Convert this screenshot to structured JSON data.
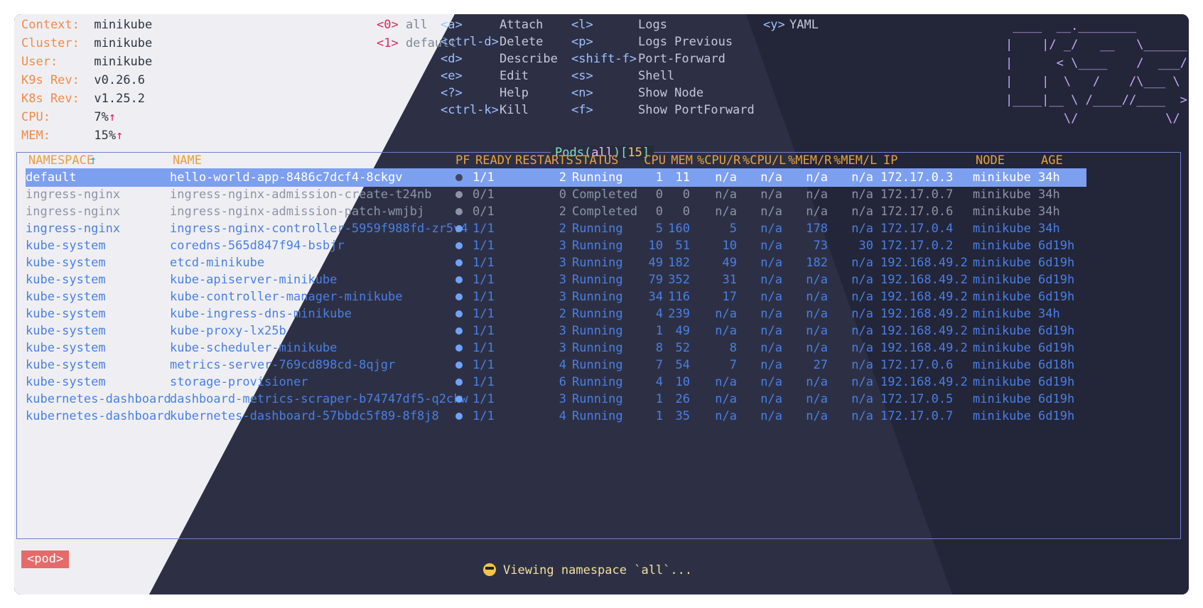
{
  "header": {
    "context": {
      "label": "Context:",
      "value": "minikube"
    },
    "cluster": {
      "label": "Cluster:",
      "value": "minikube"
    },
    "user": {
      "label": "User:",
      "value": "minikube"
    },
    "k9s_rev": {
      "label": "K9s Rev:",
      "value": "v0.26.6"
    },
    "k8s_rev": {
      "label": "K8s Rev:",
      "value": "v1.25.2"
    },
    "cpu": {
      "label": "CPU:",
      "value": "7%",
      "trend": "↑"
    },
    "mem": {
      "label": "MEM:",
      "value": "15%",
      "trend": "↑"
    }
  },
  "namespaces": [
    {
      "shortcut": "<0>",
      "name": "all"
    },
    {
      "shortcut": "<1>",
      "name": "default"
    }
  ],
  "hotkeys": [
    {
      "key": "<a>",
      "action": "Attach"
    },
    {
      "key": "<ctrl-d>",
      "action": "Delete"
    },
    {
      "key": "<d>",
      "action": "Describe"
    },
    {
      "key": "<e>",
      "action": "Edit"
    },
    {
      "key": "<?>",
      "action": "Help"
    },
    {
      "key": "<ctrl-k>",
      "action": "Kill"
    },
    {
      "key": "<l>",
      "action": "Logs"
    },
    {
      "key": "<p>",
      "action": "Logs Previous"
    },
    {
      "key": "<shift-f>",
      "action": "Port-Forward"
    },
    {
      "key": "<s>",
      "action": "Shell"
    },
    {
      "key": "<n>",
      "action": "Show Node"
    },
    {
      "key": "<f>",
      "action": "Show PortForward"
    },
    {
      "key": "<y>",
      "action": "YAML"
    }
  ],
  "logo": " ____  __.________       \n|    |/ _/   __   \\______\n|      < \\____    /  ___/\n|    |  \\   /    /\\___ \\ \n|____|__ \\ /____//____  >\n        \\/            \\/ ",
  "table": {
    "title_resource": "Pods",
    "title_namespace": "all",
    "title_count": "15",
    "columns": {
      "namespace": "NAMESPACE",
      "sort_indicator": "↑",
      "name": "NAME",
      "pf": "PF",
      "ready": "READY",
      "restarts": "RESTARTS",
      "status": "STATUS",
      "cpu": "CPU",
      "mem": "MEM",
      "cpu_r": "%CPU/R",
      "cpu_l": "%CPU/L",
      "mem_r": "%MEM/R",
      "mem_l": "%MEM/L",
      "ip": "IP",
      "node": "NODE",
      "age": "AGE"
    },
    "rows": [
      {
        "namespace": "default",
        "name": "hello-world-app-8486c7dcf4-8ckgv",
        "ready": "1/1",
        "restarts": "2",
        "status": "Running",
        "cpu": "1",
        "mem": "11",
        "cpu_r": "n/a",
        "cpu_l": "n/a",
        "mem_r": "n/a",
        "mem_l": "n/a",
        "ip": "172.17.0.3",
        "node": "minikube",
        "age": "34h",
        "style": "selected"
      },
      {
        "namespace": "ingress-nginx",
        "name": "ingress-nginx-admission-create-t24nb",
        "ready": "0/1",
        "restarts": "0",
        "status": "Completed",
        "cpu": "0",
        "mem": "0",
        "cpu_r": "n/a",
        "cpu_l": "n/a",
        "mem_r": "n/a",
        "mem_l": "n/a",
        "ip": "172.17.0.7",
        "node": "minikube",
        "age": "34h",
        "style": "dim"
      },
      {
        "namespace": "ingress-nginx",
        "name": "ingress-nginx-admission-patch-wmjbj",
        "ready": "0/1",
        "restarts": "2",
        "status": "Completed",
        "cpu": "0",
        "mem": "0",
        "cpu_r": "n/a",
        "cpu_l": "n/a",
        "mem_r": "n/a",
        "mem_l": "n/a",
        "ip": "172.17.0.6",
        "node": "minikube",
        "age": "34h",
        "style": "dim"
      },
      {
        "namespace": "ingress-nginx",
        "name": "ingress-nginx-controller-5959f988fd-zr5v4",
        "ready": "1/1",
        "restarts": "2",
        "status": "Running",
        "cpu": "5",
        "mem": "160",
        "cpu_r": "5",
        "cpu_l": "n/a",
        "mem_r": "178",
        "mem_l": "n/a",
        "ip": "172.17.0.4",
        "node": "minikube",
        "age": "34h",
        "style": "normal"
      },
      {
        "namespace": "kube-system",
        "name": "coredns-565d847f94-bsbjr",
        "ready": "1/1",
        "restarts": "3",
        "status": "Running",
        "cpu": "10",
        "mem": "51",
        "cpu_r": "10",
        "cpu_l": "n/a",
        "mem_r": "73",
        "mem_l": "30",
        "ip": "172.17.0.2",
        "node": "minikube",
        "age": "6d19h",
        "style": "normal"
      },
      {
        "namespace": "kube-system",
        "name": "etcd-minikube",
        "ready": "1/1",
        "restarts": "3",
        "status": "Running",
        "cpu": "49",
        "mem": "182",
        "cpu_r": "49",
        "cpu_l": "n/a",
        "mem_r": "182",
        "mem_l": "n/a",
        "ip": "192.168.49.2",
        "node": "minikube",
        "age": "6d19h",
        "style": "normal"
      },
      {
        "namespace": "kube-system",
        "name": "kube-apiserver-minikube",
        "ready": "1/1",
        "restarts": "3",
        "status": "Running",
        "cpu": "79",
        "mem": "352",
        "cpu_r": "31",
        "cpu_l": "n/a",
        "mem_r": "n/a",
        "mem_l": "n/a",
        "ip": "192.168.49.2",
        "node": "minikube",
        "age": "6d19h",
        "style": "normal"
      },
      {
        "namespace": "kube-system",
        "name": "kube-controller-manager-minikube",
        "ready": "1/1",
        "restarts": "3",
        "status": "Running",
        "cpu": "34",
        "mem": "116",
        "cpu_r": "17",
        "cpu_l": "n/a",
        "mem_r": "n/a",
        "mem_l": "n/a",
        "ip": "192.168.49.2",
        "node": "minikube",
        "age": "6d19h",
        "style": "normal"
      },
      {
        "namespace": "kube-system",
        "name": "kube-ingress-dns-minikube",
        "ready": "1/1",
        "restarts": "2",
        "status": "Running",
        "cpu": "4",
        "mem": "239",
        "cpu_r": "n/a",
        "cpu_l": "n/a",
        "mem_r": "n/a",
        "mem_l": "n/a",
        "ip": "192.168.49.2",
        "node": "minikube",
        "age": "34h",
        "style": "normal"
      },
      {
        "namespace": "kube-system",
        "name": "kube-proxy-lx25b",
        "ready": "1/1",
        "restarts": "3",
        "status": "Running",
        "cpu": "1",
        "mem": "49",
        "cpu_r": "n/a",
        "cpu_l": "n/a",
        "mem_r": "n/a",
        "mem_l": "n/a",
        "ip": "192.168.49.2",
        "node": "minikube",
        "age": "6d19h",
        "style": "normal"
      },
      {
        "namespace": "kube-system",
        "name": "kube-scheduler-minikube",
        "ready": "1/1",
        "restarts": "3",
        "status": "Running",
        "cpu": "8",
        "mem": "52",
        "cpu_r": "8",
        "cpu_l": "n/a",
        "mem_r": "n/a",
        "mem_l": "n/a",
        "ip": "192.168.49.2",
        "node": "minikube",
        "age": "6d19h",
        "style": "normal"
      },
      {
        "namespace": "kube-system",
        "name": "metrics-server-769cd898cd-8qjgr",
        "ready": "1/1",
        "restarts": "4",
        "status": "Running",
        "cpu": "7",
        "mem": "54",
        "cpu_r": "7",
        "cpu_l": "n/a",
        "mem_r": "27",
        "mem_l": "n/a",
        "ip": "172.17.0.6",
        "node": "minikube",
        "age": "6d18h",
        "style": "normal"
      },
      {
        "namespace": "kube-system",
        "name": "storage-provisioner",
        "ready": "1/1",
        "restarts": "6",
        "status": "Running",
        "cpu": "4",
        "mem": "10",
        "cpu_r": "n/a",
        "cpu_l": "n/a",
        "mem_r": "n/a",
        "mem_l": "n/a",
        "ip": "192.168.49.2",
        "node": "minikube",
        "age": "6d19h",
        "style": "normal"
      },
      {
        "namespace": "kubernetes-dashboard",
        "name": "dashboard-metrics-scraper-b74747df5-q2ckw",
        "ready": "1/1",
        "restarts": "3",
        "status": "Running",
        "cpu": "1",
        "mem": "26",
        "cpu_r": "n/a",
        "cpu_l": "n/a",
        "mem_r": "n/a",
        "mem_l": "n/a",
        "ip": "172.17.0.5",
        "node": "minikube",
        "age": "6d19h",
        "style": "normal"
      },
      {
        "namespace": "kubernetes-dashboard",
        "name": "kubernetes-dashboard-57bbdc5f89-8f8j8",
        "ready": "1/1",
        "restarts": "4",
        "status": "Running",
        "cpu": "1",
        "mem": "35",
        "cpu_r": "n/a",
        "cpu_l": "n/a",
        "mem_r": "n/a",
        "mem_l": "n/a",
        "ip": "172.17.0.7",
        "node": "minikube",
        "age": "6d19h",
        "style": "normal"
      }
    ]
  },
  "crumb": "<pod>",
  "flash": {
    "icon": "sunglasses-emoji-icon",
    "text": "Viewing namespace `all`..."
  },
  "colors": {
    "accent_orange": "#f08a48",
    "row_blue": "#4a7fe3",
    "selected_row": "#7d9ff0",
    "crumb_red": "#e56b6b",
    "logo_purple": "#c9a9f5"
  }
}
